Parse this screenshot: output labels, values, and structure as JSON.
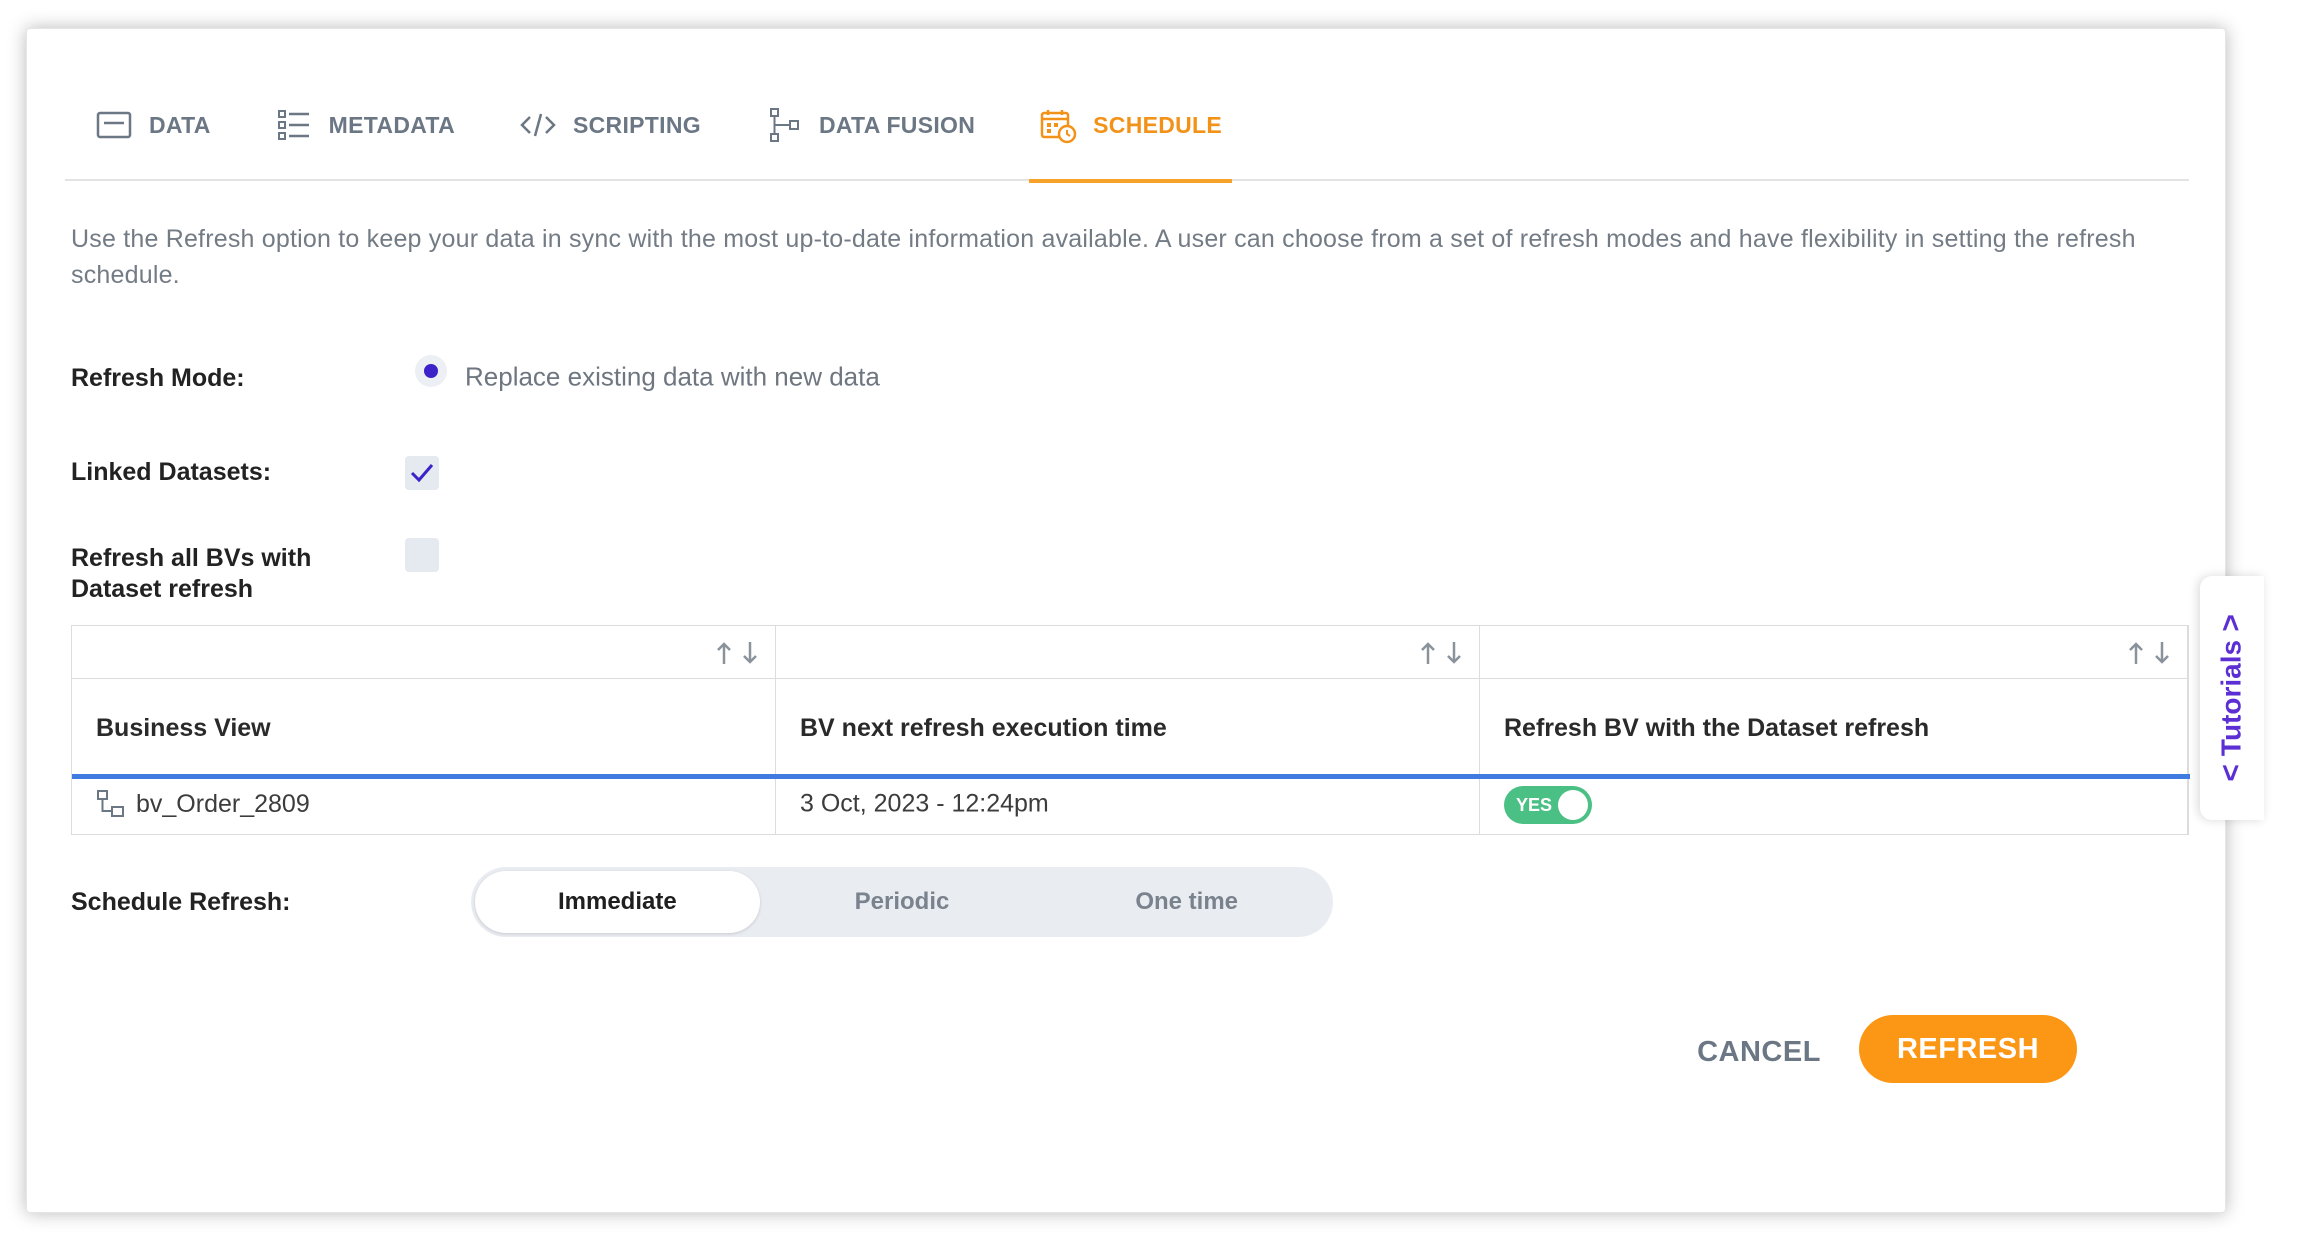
{
  "tabs": [
    {
      "label": "DATA",
      "icon": "data-icon"
    },
    {
      "label": "METADATA",
      "icon": "list-icon"
    },
    {
      "label": "SCRIPTING",
      "icon": "code-icon"
    },
    {
      "label": "DATA FUSION",
      "icon": "fusion-icon"
    },
    {
      "label": "SCHEDULE",
      "icon": "calendar-clock-icon",
      "active": true
    }
  ],
  "description": "Use the Refresh option to keep your data in sync with the most up-to-date information available. A user can choose from a set of refresh modes and have flexibility in setting the refresh schedule.",
  "refresh_mode": {
    "label": "Refresh Mode:",
    "option": "Replace existing data with new data"
  },
  "linked_datasets": {
    "label": "Linked Datasets:",
    "checked": true
  },
  "refresh_all_bvs": {
    "label_line1": "Refresh all BVs with",
    "label_line2": "Dataset refresh",
    "checked": false
  },
  "table": {
    "columns": [
      "Business View",
      "BV next refresh execution time",
      "Refresh BV with the Dataset refresh"
    ],
    "rows": [
      {
        "business_view": "bv_Order_2809",
        "next_time": "3 Oct, 2023 - 12:24pm",
        "refresh_toggle": "YES"
      }
    ]
  },
  "schedule": {
    "label": "Schedule Refresh:",
    "options": [
      "Immediate",
      "Periodic",
      "One time"
    ],
    "selected": "Immediate"
  },
  "actions": {
    "cancel": "CANCEL",
    "refresh": "REFRESH"
  },
  "tutorials": {
    "label": "Tutorials",
    "chevron": "<"
  },
  "colors": {
    "accent_orange": "#f39219",
    "button_orange": "#fb9715",
    "radio_purple": "#3b22c9",
    "toggle_green": "#4bc085",
    "table_blue": "#3f7be0",
    "tutorials_purple": "#5b2fd4"
  }
}
